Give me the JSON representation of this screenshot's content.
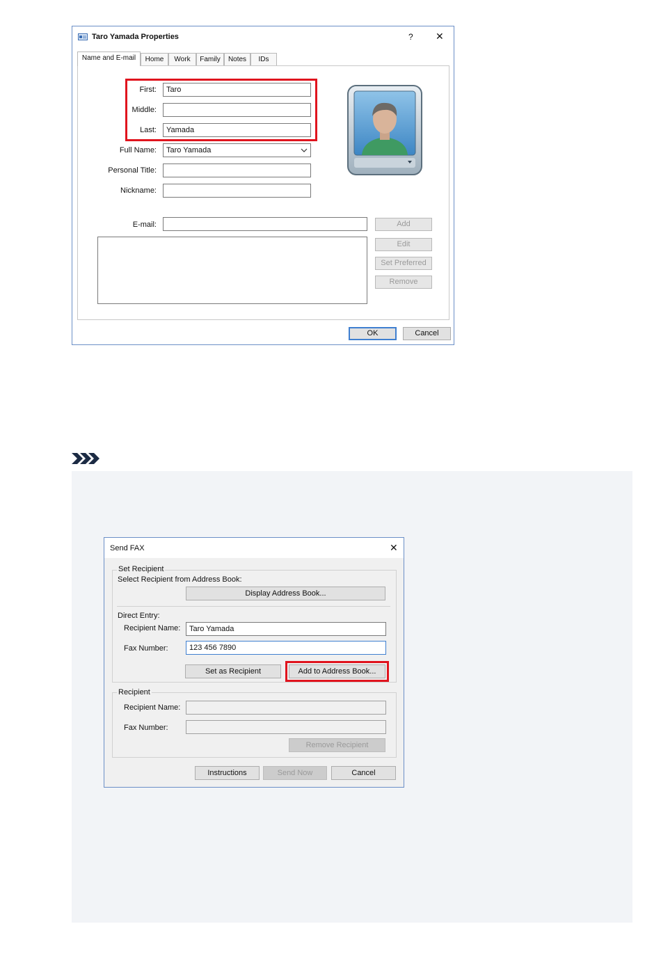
{
  "properties_dialog": {
    "title": "Taro Yamada Properties",
    "help_label": "?",
    "close_label": "✕",
    "tabs": [
      "Name and E-mail",
      "Home",
      "Work",
      "Family",
      "Notes",
      "IDs"
    ],
    "labels": {
      "first": "First:",
      "middle": "Middle:",
      "last": "Last:",
      "full_name": "Full Name:",
      "personal_title": "Personal Title:",
      "nickname": "Nickname:",
      "email": "E-mail:"
    },
    "values": {
      "first": "Taro",
      "middle": "",
      "last": "Yamada",
      "full_name": "Taro Yamada",
      "personal_title": "",
      "nickname": "",
      "email": ""
    },
    "buttons": {
      "add": "Add",
      "edit": "Edit",
      "set_preferred": "Set Preferred",
      "remove": "Remove",
      "ok": "OK",
      "cancel": "Cancel"
    },
    "highlight_color": "#e0141e"
  },
  "note_section": {
    "icon": "note-chevrons-icon",
    "background": "#f2f4f7"
  },
  "fax_dialog": {
    "title": "Send FAX",
    "close_label": "✕",
    "set_recipient_group": "Set Recipient",
    "select_from_book_label": "Select Recipient from Address Book:",
    "display_address_book": "Display Address Book...",
    "direct_entry_label": "Direct Entry:",
    "recipient_name_label": "Recipient Name:",
    "fax_number_label": "Fax Number:",
    "recipient_name_value": "Taro Yamada",
    "fax_number_value": "123 456 7890",
    "set_as_recipient": "Set as Recipient",
    "add_to_address_book": "Add to Address Book...",
    "recipient_group": "Recipient",
    "recipient_name_label2": "Recipient Name:",
    "fax_number_label2": "Fax Number:",
    "recipient_name_value2": "",
    "fax_number_value2": "",
    "remove_recipient": "Remove Recipient",
    "instructions": "Instructions",
    "send_now": "Send Now",
    "cancel": "Cancel"
  }
}
